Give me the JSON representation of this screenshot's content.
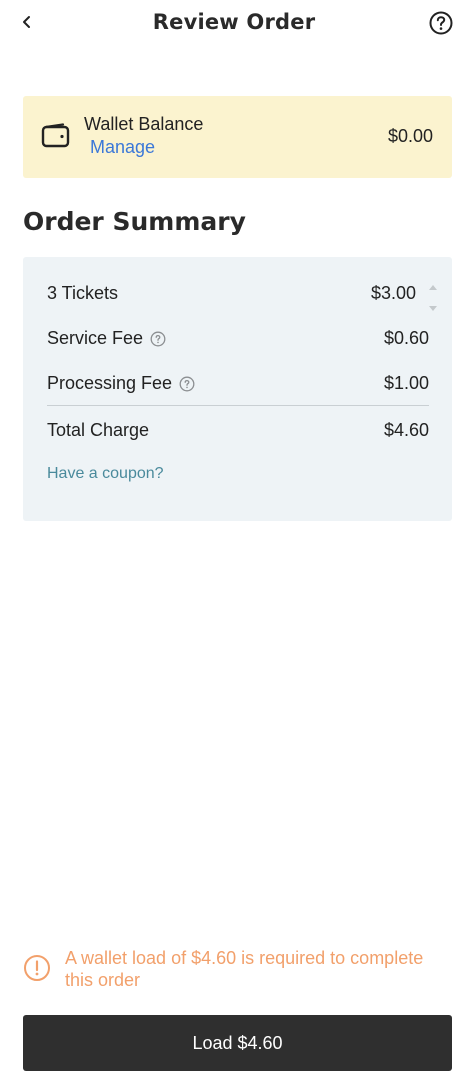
{
  "header": {
    "title": "Review Order",
    "back_icon": "chevron-left-icon",
    "help_icon": "help-circle-icon"
  },
  "wallet": {
    "title": "Wallet Balance",
    "manage_label": "Manage",
    "balance": "$0.00",
    "icon": "wallet-icon"
  },
  "summary": {
    "heading": "Order Summary",
    "lines": [
      {
        "label": "3 Tickets",
        "value": "$3.00"
      },
      {
        "label": "Service Fee",
        "value": "$0.60",
        "info_icon": "info-circle-icon"
      },
      {
        "label": "Processing Fee",
        "value": "$1.00",
        "info_icon": "info-circle-icon"
      }
    ],
    "total": {
      "label": "Total Charge",
      "value": "$4.60"
    },
    "coupon_label": "Have a coupon?"
  },
  "notice": {
    "icon": "alert-circle-icon",
    "text": "A wallet load of $4.60 is required to complete this order"
  },
  "action": {
    "button_label": "Load $4.60"
  },
  "colors": {
    "wallet_card_bg": "#fbf3cf",
    "summary_card_bg": "#eef3f6",
    "link_blue": "#3b78d8",
    "coupon_teal": "#4a8a9c",
    "warning_orange": "#f2a06b",
    "button_bg": "#2f2f2f"
  }
}
